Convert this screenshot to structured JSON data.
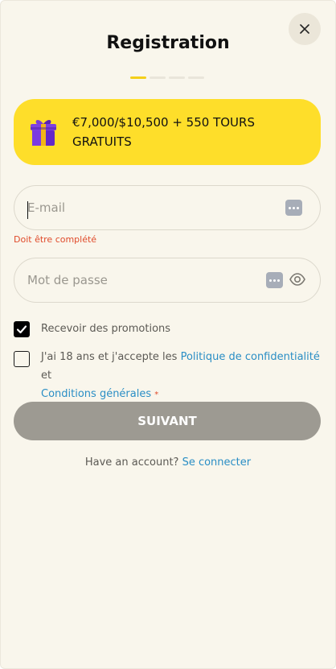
{
  "modal": {
    "title": "Registration",
    "close_icon": "close-icon",
    "steps_total": 4,
    "current_step": 1
  },
  "bonus": {
    "icon": "gift-icon",
    "text": "€7,000/$10,500 + 550 TOURS GRATUITS"
  },
  "email": {
    "placeholder": "E-mail",
    "value": "",
    "error": "Doit être complété",
    "icon": "password-manager-icon"
  },
  "password": {
    "placeholder": "Mot de passe",
    "value": "",
    "icon": "password-manager-icon",
    "toggle_icon": "eye-icon"
  },
  "promotions": {
    "label": "Recevoir des promotions",
    "checked": true
  },
  "terms": {
    "text_prefix": "J'ai 18 ans et j'accepte les ",
    "privacy_link": "Politique de confidentialité",
    "text_and": " et",
    "conditions_link": "Conditions générales",
    "required_mark": "*",
    "checked": false
  },
  "submit": {
    "label": "SUIVANT"
  },
  "signin": {
    "prompt": "Have an account? ",
    "link": "Se connecter"
  },
  "colors": {
    "background": "#f9f6ec",
    "accent_yellow": "#fede2a",
    "link_blue": "#2a8ec5",
    "error_red": "#e04b2b",
    "button_disabled": "#9d9a92"
  }
}
